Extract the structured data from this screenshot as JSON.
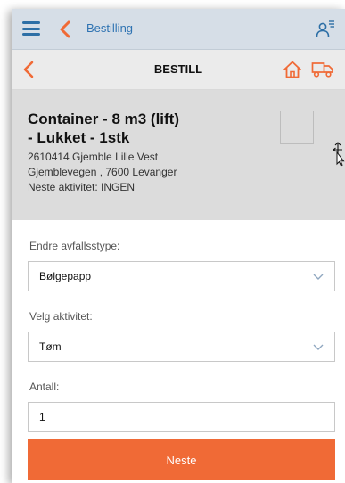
{
  "topbar": {
    "title": "Bestilling",
    "menu_icon": "hamburger-menu-icon",
    "back_icon": "chevron-left-icon",
    "user_icon": "user-list-icon",
    "accent_color": "#2f73b2"
  },
  "header": {
    "title": "BESTILL",
    "back_icon": "chevron-left-icon",
    "home_icon": "home-icon",
    "truck_icon": "truck-icon",
    "accent_color": "#f06a36"
  },
  "container": {
    "title_line1": "Container - 8 m3 (lift)",
    "title_line2": "- Lukket - 1stk",
    "address_line1": "2610414 Gjemble Lille Vest",
    "address_line2": "Gjemblevegen , 7600 Levanger",
    "next_activity": "Neste aktivitet: INGEN"
  },
  "form": {
    "waste_type_label": "Endre avfallsstype:",
    "waste_type_value": "Bølgepapp",
    "activity_label": "Velg aktivitet:",
    "activity_value": "Tøm",
    "quantity_label": "Antall:",
    "quantity_value": "1",
    "submit_label": "Neste"
  }
}
